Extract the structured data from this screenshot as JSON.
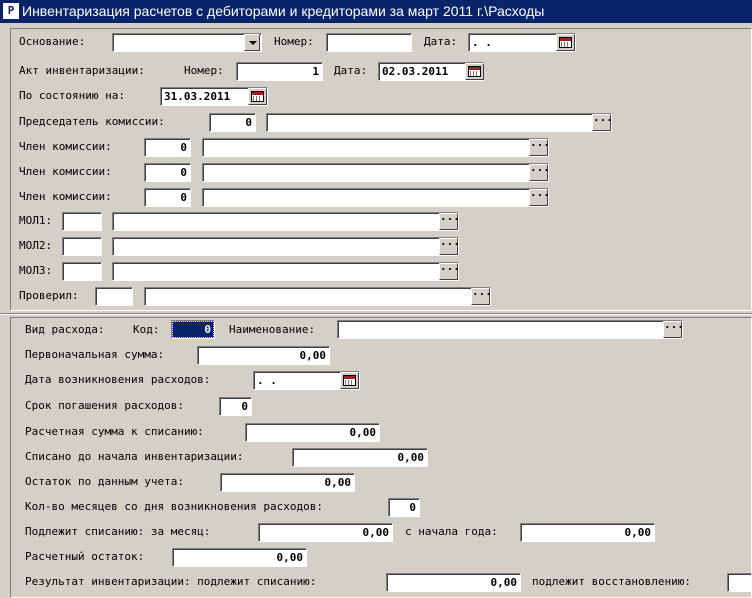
{
  "window": {
    "title": "Инвентаризация расчетов с дебиторами и кредиторами за март 2011 г.\\Расходы",
    "icon": "app-logo-icon"
  },
  "header": {
    "osnovanie_label": "Основание:",
    "osnovanie_value": "",
    "nomer_label": "Номер:",
    "nomer_value": "",
    "data_label": "Дата:",
    "data_value": " .  .",
    "akt_label": "Акт инвентаризации:",
    "akt_nomer_label": "Номер:",
    "akt_nomer_value": "1",
    "akt_data_label": "Дата:",
    "akt_data_value": "02.03.2011",
    "sostoyanie_label": "По состоянию на:",
    "sostoyanie_value": "31.03.2011",
    "predsedatel_label": "Председатель комиссии:",
    "predsedatel_code": "0",
    "predsedatel_name": "",
    "members": [
      {
        "label": "Член комиссии:",
        "code": "0",
        "name": ""
      },
      {
        "label": "Член комиссии:",
        "code": "0",
        "name": ""
      },
      {
        "label": "Член комиссии:",
        "code": "0",
        "name": ""
      }
    ],
    "mol": [
      {
        "label": "МОЛ1:",
        "code": "",
        "name": ""
      },
      {
        "label": "МОЛ2:",
        "code": "",
        "name": ""
      },
      {
        "label": "МОЛ3:",
        "code": "",
        "name": ""
      }
    ],
    "proveril_label": "Проверил:",
    "proveril_code": "",
    "proveril_name": "",
    "ellipsis": "···"
  },
  "detail": {
    "vid_label": "Вид расхода:",
    "kod_label": "Код:",
    "kod_value": "0",
    "naim_label": "Наименование:",
    "naim_value": "",
    "perv_label": "Первоначальная сумма:",
    "perv_value": "0,00",
    "data_voz_label": "Дата возникновения расходов:",
    "data_voz_value": " .  .",
    "srok_label": "Срок погашения расходов:",
    "srok_value": "0",
    "rasch_label": "Расчетная сумма к списанию:",
    "rasch_value": "0,00",
    "spisano_label": "Списано до начала инвентаризации:",
    "spisano_value": "0,00",
    "ostatok_label": "Остаток по данным учета:",
    "ostatok_value": "0,00",
    "kolvo_label": "Кол-во месяцев со дня возникновения расходов:",
    "kolvo_value": "0",
    "podl_label": "Подлежит списанию:  за месяц:",
    "podl_month_value": "0,00",
    "podl_year_label": "с начала года:",
    "podl_year_value": "0,00",
    "rasch_ost_label": "Расчетный остаток:",
    "rasch_ost_value": "0,00",
    "result_label": "Результат инвентаризации:  подлежит списанию:",
    "result_spis_value": "0,00",
    "result_vost_label": "подлежит восстановлению:",
    "result_vost_value": ""
  }
}
